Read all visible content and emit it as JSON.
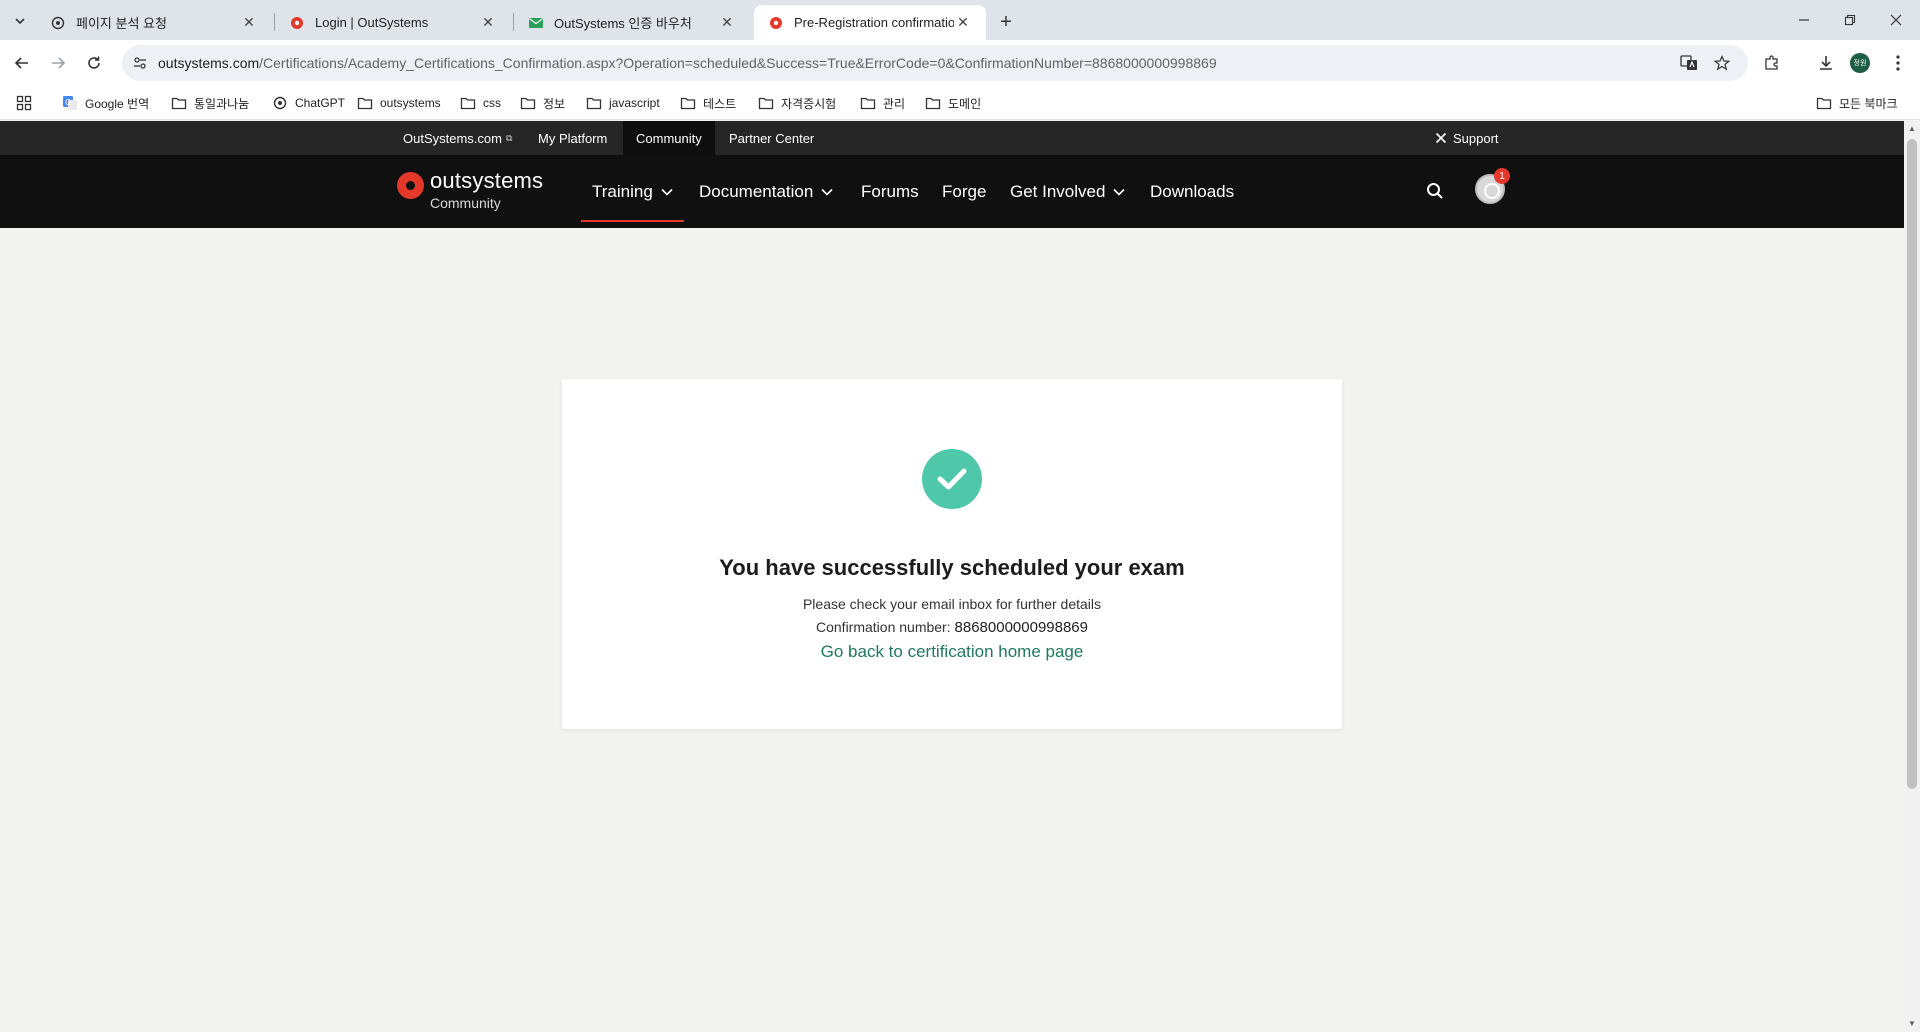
{
  "browser": {
    "tabs": [
      {
        "title": "페이지 분석 요청",
        "icon": "chatgpt-icon",
        "active": false
      },
      {
        "title": "Login | OutSystems",
        "icon": "outsystems-icon",
        "active": false
      },
      {
        "title": "OutSystems 인증 바우처",
        "icon": "mail-icon",
        "active": false
      },
      {
        "title": "Pre-Registration confirmation",
        "icon": "outsystems-icon",
        "active": true
      }
    ],
    "url_host": "outsystems.com",
    "url_path": "/Certifications/Academy_Certifications_Confirmation.aspx?Operation=scheduled&Success=True&ErrorCode=0&ConfirmationNumber=8868000000998869",
    "profile_initials": "정원",
    "bookmarks": [
      {
        "label": "Google 번역",
        "icon": "google-translate-icon"
      },
      {
        "label": "통일과나눔",
        "icon": "folder-icon"
      },
      {
        "label": "ChatGPT",
        "icon": "chatgpt-icon"
      },
      {
        "label": "outsystems",
        "icon": "folder-icon"
      },
      {
        "label": "css",
        "icon": "folder-icon"
      },
      {
        "label": "정보",
        "icon": "folder-icon"
      },
      {
        "label": "javascript",
        "icon": "folder-icon"
      },
      {
        "label": "테스트",
        "icon": "folder-icon"
      },
      {
        "label": "자격증시험",
        "icon": "folder-icon"
      },
      {
        "label": "관리",
        "icon": "folder-icon"
      },
      {
        "label": "도메인",
        "icon": "folder-icon"
      }
    ],
    "all_bookmarks": "모든 북마크"
  },
  "site": {
    "topstrip": {
      "outsystems_com": "OutSystems.com",
      "my_platform": "My Platform",
      "community": "Community",
      "partner_center": "Partner Center",
      "support": "Support"
    },
    "logo_word": "outsystems",
    "logo_sub": "Community",
    "nav": [
      {
        "label": "Training",
        "dropdown": true,
        "active": true
      },
      {
        "label": "Documentation",
        "dropdown": true,
        "active": false
      },
      {
        "label": "Forums",
        "dropdown": false,
        "active": false
      },
      {
        "label": "Forge",
        "dropdown": false,
        "active": false
      },
      {
        "label": "Get Involved",
        "dropdown": true,
        "active": false
      },
      {
        "label": "Downloads",
        "dropdown": false,
        "active": false
      }
    ],
    "notification_count": "1",
    "accent_color": "#e4382a"
  },
  "confirmation": {
    "title": "You have successfully scheduled your exam",
    "email_note": "Please check your email inbox for further details",
    "confirmation_label": "Confirmation number: ",
    "confirmation_number": "8868000000998869",
    "back_link": "Go back to certification home page",
    "check_color": "#4fc7a9"
  }
}
